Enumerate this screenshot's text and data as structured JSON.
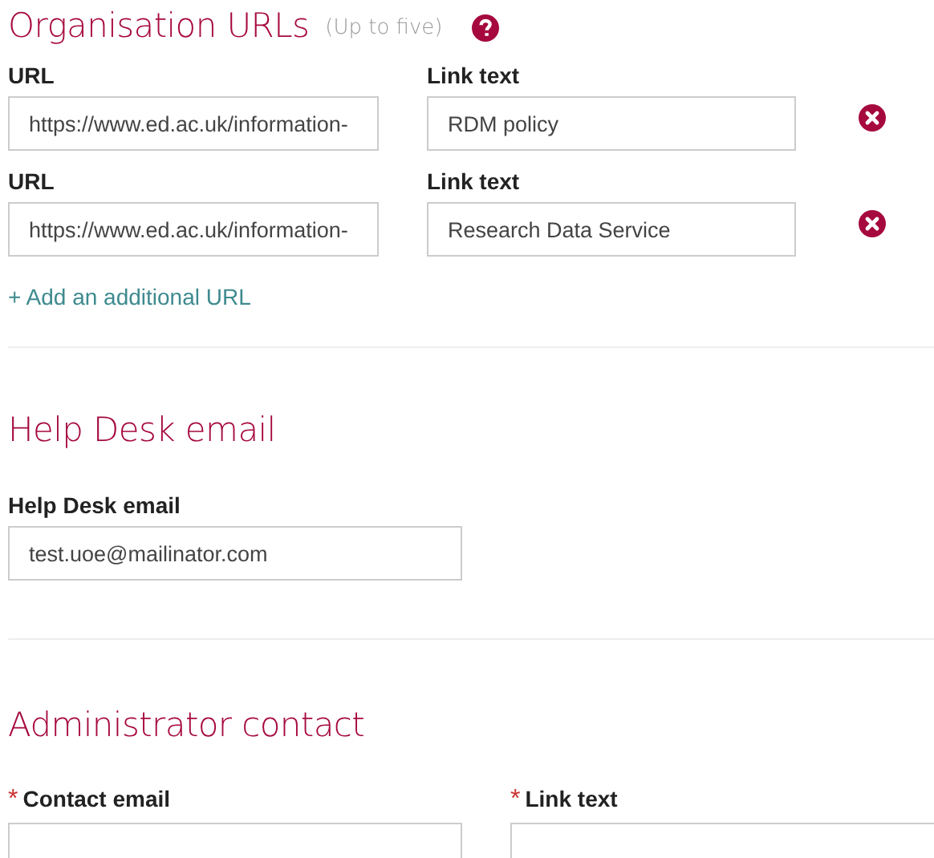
{
  "organisation_urls": {
    "title": "Organisation URLs",
    "hint": "(Up to five)",
    "rows": [
      {
        "url_label": "URL",
        "url_value": "https://www.ed.ac.uk/information-",
        "text_label": "Link text",
        "text_value": "RDM policy"
      },
      {
        "url_label": "URL",
        "url_value": "https://www.ed.ac.uk/information-",
        "text_label": "Link text",
        "text_value": "Research Data Service"
      }
    ],
    "add_link": "+ Add an additional URL"
  },
  "help_desk": {
    "title": "Help Desk email",
    "label": "Help Desk email",
    "value": "test.uoe@mailinator.com"
  },
  "administrator_contact": {
    "title": "Administrator contact",
    "fields": [
      {
        "required_mark": "*",
        "label": "Contact email"
      },
      {
        "required_mark": "*",
        "label": "Link text"
      }
    ]
  }
}
